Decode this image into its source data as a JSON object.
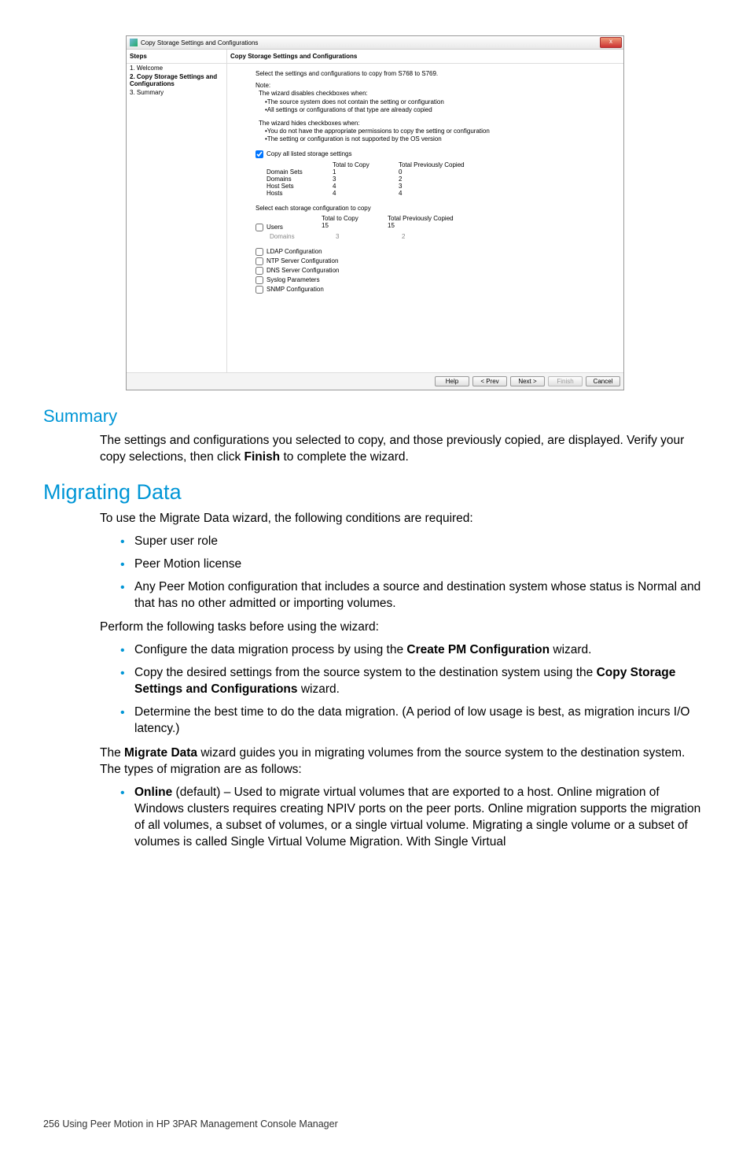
{
  "screenshot": {
    "window_title": "Copy Storage Settings and Configurations",
    "steps_label": "Steps",
    "steps": [
      "1. Welcome",
      "2. Copy Storage Settings and Configurations",
      "3. Summary"
    ],
    "content_title": "Copy Storage Settings and Configurations",
    "instruction": "Select the settings and configurations to copy from S768 to S769.",
    "note_label": "Note:",
    "note1_intro": "The wizard disables checkboxes when:",
    "note1_bullet1": "•The source system does not contain the setting or configuration",
    "note1_bullet2": "•All settings or configurations of that type are already copied",
    "note2_intro": "The wizard hides checkboxes when:",
    "note2_bullet1": "•You do not have the appropriate permissions to copy the setting or configuration",
    "note2_bullet2": "•The setting or configuration is not supported by the OS version",
    "copy_all_label": "Copy all listed storage settings",
    "col_total": "Total to Copy",
    "col_prev": "Total Previously Copied",
    "settings_rows": [
      {
        "name": "Domain Sets",
        "total": "1",
        "prev": "0"
      },
      {
        "name": "Domains",
        "total": "3",
        "prev": "2"
      },
      {
        "name": "Host Sets",
        "total": "4",
        "prev": "3"
      },
      {
        "name": "Hosts",
        "total": "4",
        "prev": "4"
      }
    ],
    "select_each_label": "Select each storage configuration to copy",
    "config_rows": [
      {
        "name": "Users",
        "total": "15",
        "prev": "15"
      },
      {
        "name": "Domains",
        "total": "3",
        "prev": "2",
        "sub": true
      }
    ],
    "extra_checks": [
      "LDAP Configuration",
      "NTP Server Configuration",
      "DNS Server Configuration",
      "Syslog Parameters",
      "SNMP Configuration"
    ],
    "buttons": {
      "help": "Help",
      "prev": "< Prev",
      "next": "Next >",
      "finish": "Finish",
      "cancel": "Cancel"
    }
  },
  "doc": {
    "summary_heading": "Summary",
    "summary_text_pre": "The settings and configurations you selected to copy, and those previously copied, are displayed. Verify your copy selections, then click ",
    "summary_bold": "Finish",
    "summary_text_post": " to complete the wizard.",
    "migrate_heading": "Migrating Data",
    "migrate_intro": "To use the Migrate Data wizard, the following conditions are required:",
    "req1": "Super user role",
    "req2": "Peer Motion license",
    "req3": "Any Peer Motion configuration that includes a source and destination system whose status is Normal and that has no other admitted or importing volumes.",
    "perform_intro": "Perform the following tasks before using the wizard:",
    "task1_pre": "Configure the data migration process by using the ",
    "task1_bold": "Create PM Configuration",
    "task1_post": " wizard.",
    "task2_pre": "Copy the desired settings from the source system to the destination system using the ",
    "task2_bold": "Copy Storage Settings and Configurations",
    "task2_post": " wizard.",
    "task3": "Determine the best time to do the data migration. (A period of low usage is best, as migration incurs I/O latency.)",
    "wizard_para_pre": "The ",
    "wizard_para_bold": "Migrate Data",
    "wizard_para_post": " wizard guides you in migrating volumes from the source system to the destination system. The types of migration are as follows:",
    "online_bold": "Online",
    "online_text": " (default) – Used to migrate virtual volumes that are exported to a host. Online migration of Windows clusters requires creating NPIV ports on the peer ports. Online migration supports the migration of all volumes, a subset of volumes, or a single virtual volume. Migrating a single volume or a subset of volumes is called Single Virtual Volume Migration. With Single Virtual",
    "footer": "256   Using Peer Motion in HP 3PAR Management Console Manager"
  }
}
